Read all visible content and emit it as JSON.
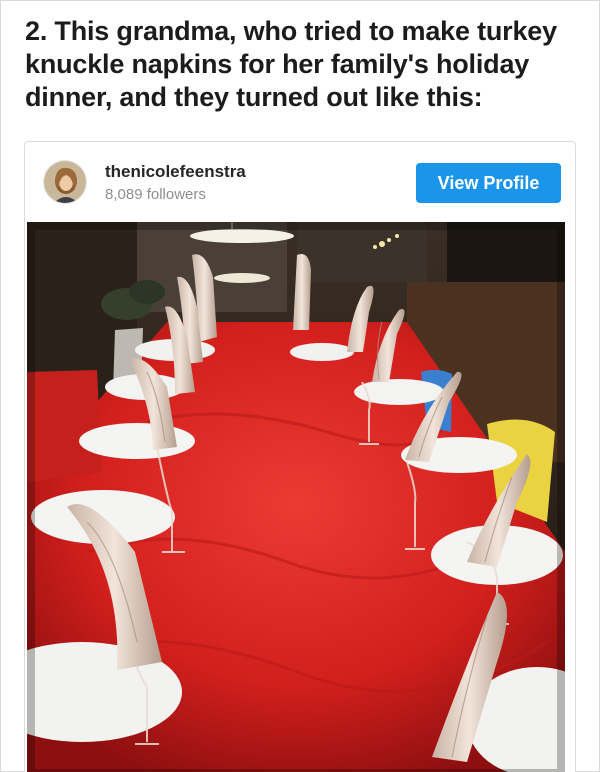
{
  "article": {
    "heading": "2. This grandma, who tried to make turkey knuckle napkins for her family's holiday dinner, and they turned out like this:"
  },
  "embed": {
    "username": "thenicolefeenstra",
    "followers": "8,089 followers",
    "view_profile_label": "View Profile",
    "avatar_icon": "profile-photo",
    "colors": {
      "button": "#1b95e9",
      "tablecloth": "#d8211f",
      "followers_text": "#8e8e8e"
    }
  }
}
